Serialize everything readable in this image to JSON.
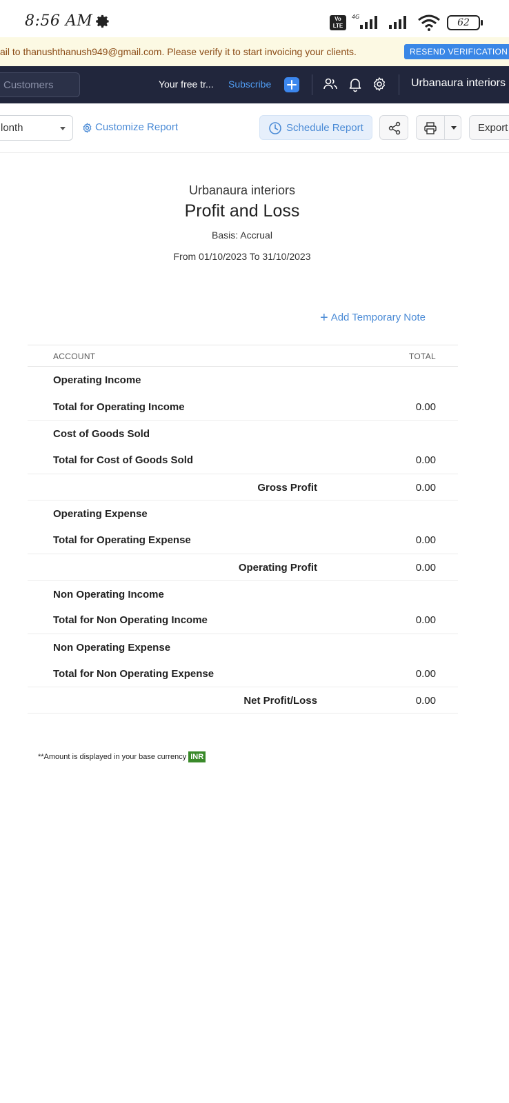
{
  "status_bar": {
    "time": "8:56 AM",
    "volte": "Vo LTE",
    "network": "4G",
    "battery": "62"
  },
  "banner": {
    "message": "ail to thanushthanush949@gmail.com. Please verify it to start invoicing your clients.",
    "button_label": "RESEND VERIFICATION E"
  },
  "navbar": {
    "search_placeholder": "Customers",
    "trial_text": "Your free tr...",
    "subscribe_label": "Subscribe",
    "org_name": "Urbanaura interiors"
  },
  "toolbar": {
    "period_value": "lonth",
    "customize_label": "Customize Report",
    "schedule_label": "Schedule Report",
    "export_label": "Export"
  },
  "report": {
    "company": "Urbanaura interiors",
    "title": "Profit and Loss",
    "basis": "Basis: Accrual",
    "range": "From 01/10/2023 To 31/10/2023",
    "add_note_label": "Add Temporary Note",
    "columns": {
      "account": "ACCOUNT",
      "total": "TOTAL"
    },
    "rows": [
      {
        "label": "Operating Income",
        "value": "",
        "align": "left",
        "border": true
      },
      {
        "label": "Total for Operating Income",
        "value": "0.00",
        "align": "left",
        "border": false
      },
      {
        "label": "Cost of Goods Sold",
        "value": "",
        "align": "left",
        "border": true
      },
      {
        "label": "Total for Cost of Goods Sold",
        "value": "0.00",
        "align": "left",
        "border": false
      },
      {
        "label": "Gross Profit",
        "value": "0.00",
        "align": "right",
        "border": true
      },
      {
        "label": "Operating Expense",
        "value": "",
        "align": "left",
        "border": true
      },
      {
        "label": "Total for Operating Expense",
        "value": "0.00",
        "align": "left",
        "border": false
      },
      {
        "label": "Operating Profit",
        "value": "0.00",
        "align": "right",
        "border": true
      },
      {
        "label": "Non Operating Income",
        "value": "",
        "align": "left",
        "border": true
      },
      {
        "label": "Total for Non Operating Income",
        "value": "0.00",
        "align": "left",
        "border": false
      },
      {
        "label": "Non Operating Expense",
        "value": "",
        "align": "left",
        "border": true
      },
      {
        "label": "Total for Non Operating Expense",
        "value": "0.00",
        "align": "left",
        "border": false
      },
      {
        "label": "Net Profit/Loss",
        "value": "0.00",
        "align": "right",
        "border": true
      }
    ],
    "footnote": "**Amount is displayed in your base currency",
    "currency": "INR"
  }
}
